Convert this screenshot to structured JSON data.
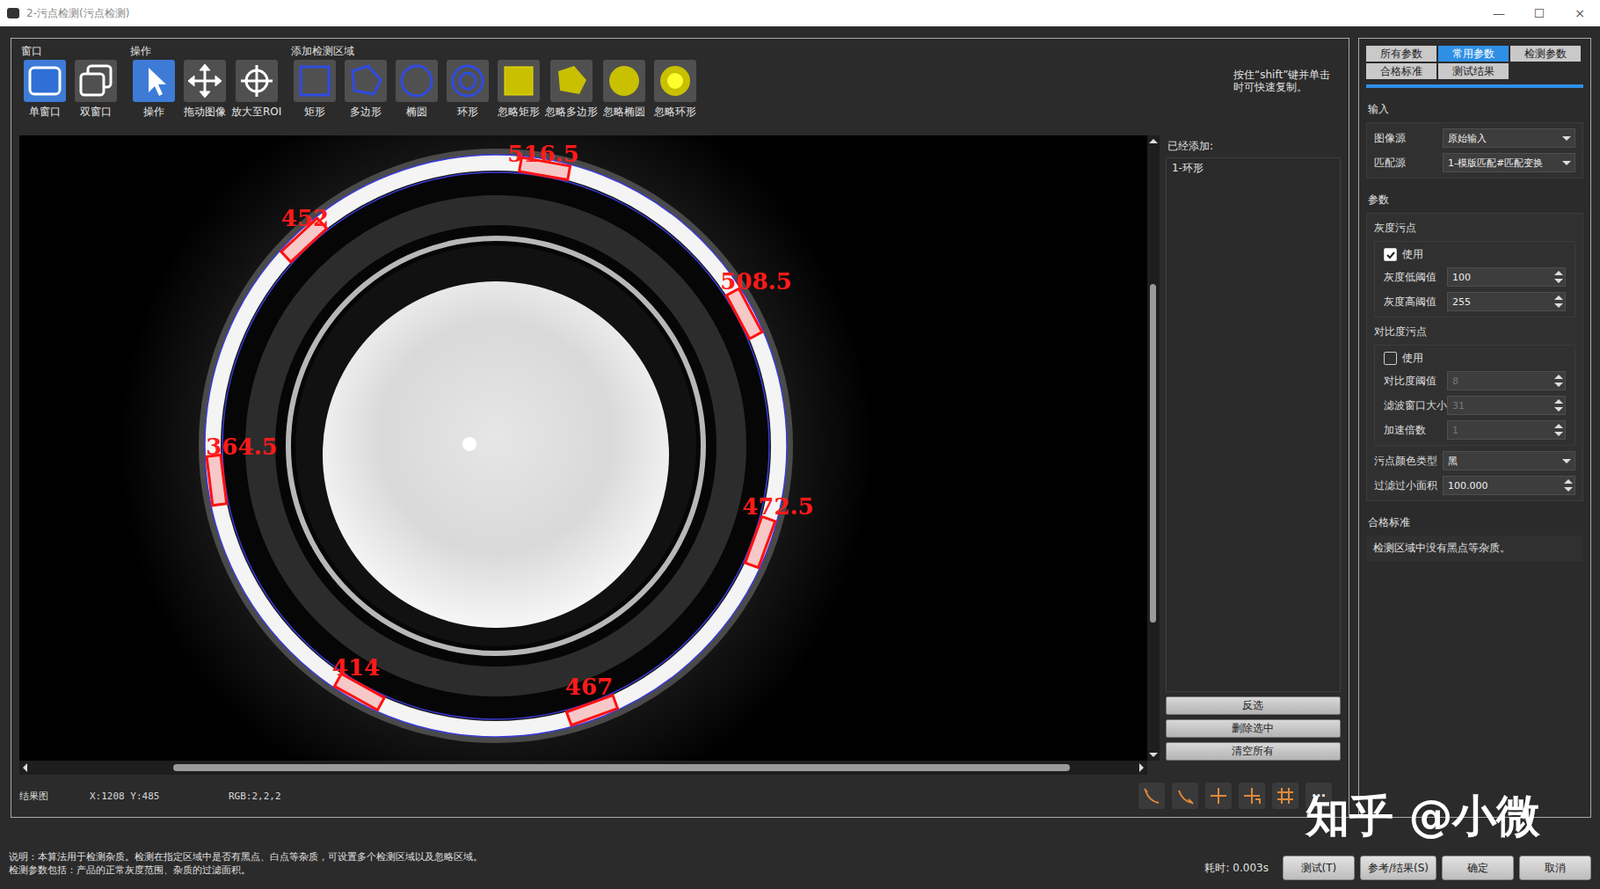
{
  "window": {
    "title": "2-污点检测(污点检测)",
    "controls": [
      "—",
      "☐",
      "×"
    ]
  },
  "toolbar": {
    "groups": [
      {
        "label": "窗口",
        "items": [
          {
            "label": "单窗口",
            "selected": true
          },
          {
            "label": "双窗口",
            "selected": false
          }
        ]
      },
      {
        "label": "操作",
        "items": [
          {
            "label": "操作",
            "selected": true
          },
          {
            "label": "拖动图像",
            "selected": false
          },
          {
            "label": "放大至ROI",
            "selected": false
          }
        ]
      },
      {
        "label": "添加检测区域",
        "items": [
          {
            "label": "矩形",
            "selected": false
          },
          {
            "label": "多边形",
            "selected": false
          },
          {
            "label": "椭圆",
            "selected": false
          },
          {
            "label": "环形",
            "selected": false
          },
          {
            "label": "忽略矩形",
            "selected": false
          },
          {
            "label": "忽略多边形",
            "selected": false
          },
          {
            "label": "忽略椭圆",
            "selected": false
          },
          {
            "label": "忽略环形",
            "selected": false
          }
        ]
      }
    ],
    "hint": "按住“shift”键并单击时可快速复制。"
  },
  "canvas": {
    "defects": [
      {
        "value": "516.5"
      },
      {
        "value": "452"
      },
      {
        "value": "508.5"
      },
      {
        "value": "364.5"
      },
      {
        "value": "472.5"
      },
      {
        "value": "414"
      },
      {
        "value": "467"
      }
    ]
  },
  "added": {
    "label": "已经添加:",
    "items": [
      {
        "label": "1-环形",
        "selected": false
      }
    ],
    "buttons": [
      "反选",
      "删除选中",
      "清空所有"
    ]
  },
  "status": {
    "view": "结果图",
    "coords": "X:1208 Y:485",
    "rgb": "RGB:2,2,2",
    "more": "···"
  },
  "panel": {
    "tabs": [
      {
        "label": "所有参数",
        "selected": false
      },
      {
        "label": "常用参数",
        "selected": true
      },
      {
        "label": "检测参数",
        "selected": false
      },
      {
        "label": "合格标准",
        "selected": false
      },
      {
        "label": "测试结果",
        "selected": false
      }
    ],
    "input_title": "输入",
    "inputs": [
      {
        "label": "图像源",
        "value": "原始输入"
      },
      {
        "label": "匹配源",
        "value": "1-模版匹配#匹配变换"
      }
    ],
    "param_title": "参数",
    "groups": [
      {
        "title": "灰度污点",
        "use_label": "使用",
        "checked": true,
        "fields": [
          {
            "label": "灰度低阈值",
            "value": "100",
            "disabled": false
          },
          {
            "label": "灰度高阈值",
            "value": "255",
            "disabled": false
          }
        ]
      },
      {
        "title": "对比度污点",
        "use_label": "使用",
        "checked": false,
        "fields": [
          {
            "label": "对比度阈值",
            "value": "8",
            "disabled": true
          },
          {
            "label": "滤波窗口大小",
            "value": "31",
            "disabled": true
          },
          {
            "label": "加速倍数",
            "value": "1",
            "disabled": true
          }
        ]
      }
    ],
    "extra": [
      {
        "kind": "select",
        "label": "污点颜色类型",
        "value": "黑"
      },
      {
        "kind": "spin",
        "label": "过滤过小面积",
        "value": "100.000"
      }
    ],
    "standard_title": "合格标准",
    "standard_text": "检测区域中没有黑点等杂质。"
  },
  "footer": {
    "description": [
      "说明：本算法用于检测杂质。检测在指定区域中是否有黑点、白点等杂质，可设置多个检测区域以及忽略区域。",
      "检测参数包括：产品的正常灰度范围、杂质的过滤面积。"
    ],
    "time_label": "耗时:",
    "time": "0.003s",
    "buttons": [
      "测试(T)",
      "参考/结果(S)",
      "确定",
      "取消"
    ]
  },
  "watermark": "知乎 @小微"
}
